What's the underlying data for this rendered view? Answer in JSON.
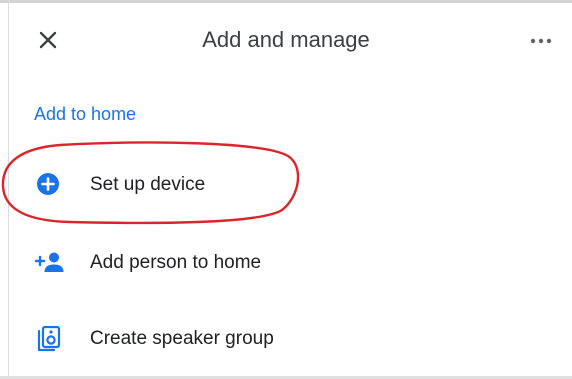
{
  "header": {
    "title": "Add and manage",
    "close_icon": "close-icon",
    "more_icon": "more-horizontal-icon"
  },
  "section": {
    "heading": "Add to home"
  },
  "menu_items": [
    {
      "label": "Set up device",
      "icon": "add-circle-icon"
    },
    {
      "label": "Add person to home",
      "icon": "person-add-icon"
    },
    {
      "label": "Create speaker group",
      "icon": "speaker-group-icon"
    }
  ],
  "annotation": {
    "highlight_color": "#d9262b"
  },
  "colors": {
    "accent": "#1a73e8",
    "text": "#202124",
    "icon_blue": "#1a73e8"
  }
}
